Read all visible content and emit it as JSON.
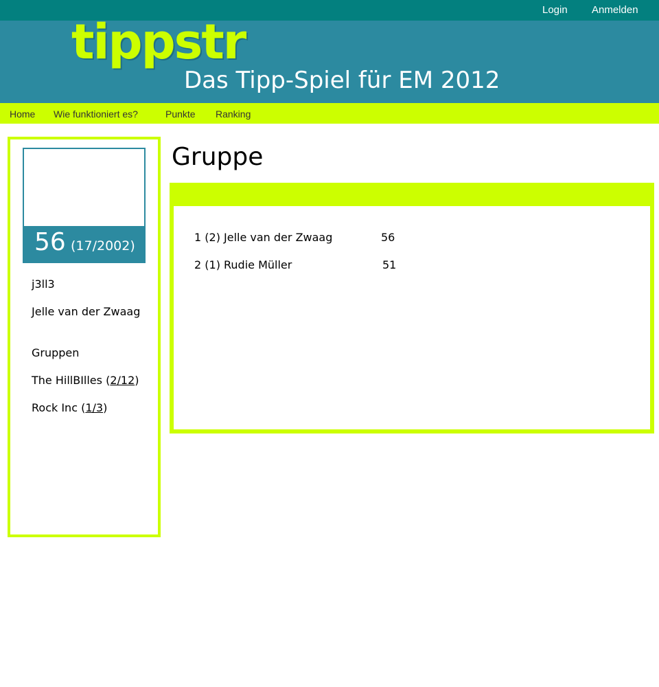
{
  "topbar": {
    "login": "Login",
    "signup": "Anmelden"
  },
  "brand": {
    "logo": "tippstr",
    "tagline": "Das Tipp-Spiel für EM 2012"
  },
  "nav": {
    "home": "Home",
    "how": "Wie funktioniert es?",
    "points": "Punkte",
    "ranking": "Ranking"
  },
  "profile": {
    "score": "56",
    "rank": "(17/2002)",
    "username": "j3ll3",
    "fullname": "Jelle van der Zwaag",
    "groups_heading": "Gruppen",
    "groups": [
      {
        "name": "The HillBIlles (",
        "rank": "2/12",
        "close": ")"
      },
      {
        "name": "Rock Inc (",
        "rank": "1/3",
        "close": ")"
      }
    ]
  },
  "page": {
    "title": "Gruppe"
  },
  "ranking": [
    {
      "label": "1 (2) Jelle van der Zwaag",
      "points": "56"
    },
    {
      "label": "2 (1) Rudie Müller",
      "points": "51"
    }
  ],
  "colors": {
    "teal_dark": "#03807f",
    "teal": "#2c8aa0",
    "lime": "#ccff00"
  }
}
